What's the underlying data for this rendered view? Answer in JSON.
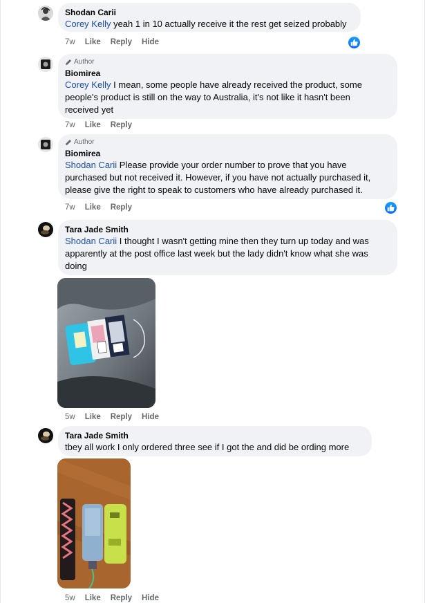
{
  "comments": [
    {
      "author": "Shodan Carii",
      "is_author": false,
      "mention": "Corey Kelly",
      "text": " yeah 1 in 10 actually receive it the rest get seized probably",
      "time": "7w",
      "actions": [
        "Like",
        "Reply",
        "Hide"
      ],
      "reaction": "like"
    },
    {
      "author": "Biomirea",
      "is_author": true,
      "badge": "Author",
      "mention": "Corey Kelly",
      "text_lines": [
        " I mean, some people have already received the product, some",
        "people's product is still on the way to Australia, it's not like it hasn't been",
        "received yet"
      ],
      "time": "7w",
      "actions": [
        "Like",
        "Reply"
      ]
    },
    {
      "author": "Biomirea",
      "is_author": true,
      "badge": "Author",
      "mention": "Shodan Carii",
      "text_lines": [
        " Please provide your order number to prove that you have",
        "purchased but not received it. However, if you have not actually purchased it,",
        "please give the right to speak to customers who have already purchased it."
      ],
      "time": "7w",
      "actions": [
        "Like",
        "Reply"
      ],
      "reaction": "like"
    },
    {
      "author": "Tara Jade Smith",
      "is_author": false,
      "mention": "Shodan Carii",
      "text_lines": [
        " I thought I wasn't getting mine then they turn up today and was",
        "apparently at the post office last week but the lady didn't know what she was",
        "doing"
      ],
      "time": "5w",
      "actions": [
        "Like",
        "Reply",
        "Hide"
      ],
      "photo": "vape-packs-on-car-seat"
    },
    {
      "author": "Tara Jade Smith",
      "is_author": false,
      "text": "tbey all work I only ordered three see if I got the and did be ording more",
      "time": "5w",
      "actions": [
        "Like",
        "Reply",
        "Hide"
      ],
      "photo": "three-vapes-on-table"
    }
  ],
  "colors": {
    "bubble": "#f0f2f5",
    "mention": "#1b4ea8",
    "meta": "#65676b",
    "like": "#0866ff"
  },
  "icons": [
    "pencil-icon",
    "thumbs-up-icon"
  ]
}
